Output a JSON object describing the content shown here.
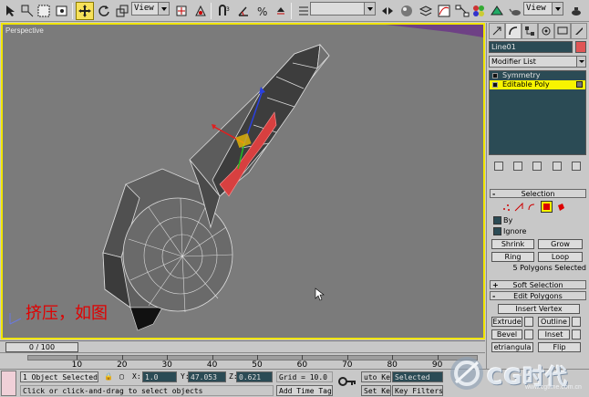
{
  "toolbar": {
    "reference_coord": "View",
    "reference_coord_2": "View",
    "named_selection": ""
  },
  "viewport": {
    "label": "Perspective",
    "caption": "挤压，如图"
  },
  "command_panel": {
    "object_name": "Line01",
    "modifier_list": "Modifier List",
    "stack": [
      {
        "label": "Symmetry",
        "selected": false
      },
      {
        "label": "Editable Poly",
        "selected": true
      }
    ],
    "selection_rollout": {
      "title": "Selection",
      "by_vertex": "By",
      "ignore_backfacing": "Ignore",
      "shrink": "Shrink",
      "grow": "Grow",
      "ring": "Ring",
      "loop": "Loop",
      "status": "5 Polygons Selected"
    },
    "soft_selection": {
      "title": "Soft Selection"
    },
    "edit_polygons": {
      "title": "Edit Polygons",
      "insert_vertex": "Insert Vertex",
      "extrude": "Extrude",
      "outline": "Outline",
      "bevel": "Bevel",
      "inset": "Inset",
      "triangulate": "etriangula",
      "flip": "Flip"
    }
  },
  "timeline": {
    "slider": "0 / 100",
    "ticks": [
      "10",
      "20",
      "30",
      "40",
      "50",
      "60",
      "70",
      "80",
      "90"
    ]
  },
  "status": {
    "selection": "1 Object Selected",
    "prompt": "Click or click-and-drag to select objects",
    "x_label": "X:",
    "x_value": "1.0",
    "y_label": "Y:",
    "y_value": "47.053",
    "z_label": "Z:",
    "z_value": "0.621",
    "grid": "Grid = 10.0",
    "add_time_tag": "Add Time Tag",
    "auto_key": "uto Ke",
    "set_key": "Set Key",
    "key_mode": "Selected",
    "key_filters": "Key Filters..."
  },
  "watermark": {
    "main": "CG时代",
    "sub": "www.cgtime.com.cn"
  },
  "colors": {
    "active_viewport_border": "#f1e500",
    "viewport_bg": "#7b7b7b",
    "selected_stack": "#f8f400",
    "caption": "#e00000",
    "selected_faces": "#d84040"
  }
}
